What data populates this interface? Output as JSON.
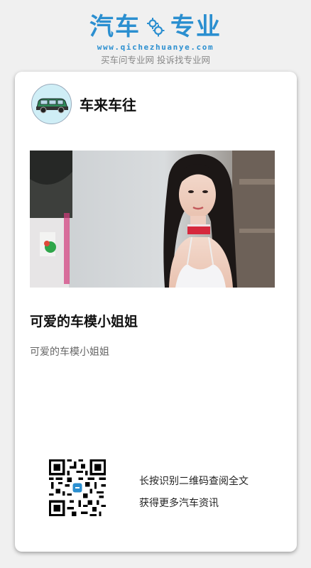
{
  "header": {
    "brand_left": "汽车",
    "brand_right": "专业",
    "url": "www.qichezhuanye.com",
    "slogan": "买车问专业网 投诉找专业网",
    "brand_color": "#2b8fd0"
  },
  "post": {
    "author_name": "车来车往",
    "avatar_icon": "car-avatar-icon",
    "title": "可爱的车模小姐姐",
    "summary": "可爱的车模小姐姐"
  },
  "footer": {
    "qr_line1": "长按识别二维码查阅全文",
    "qr_line2": "获得更多汽车资讯"
  }
}
